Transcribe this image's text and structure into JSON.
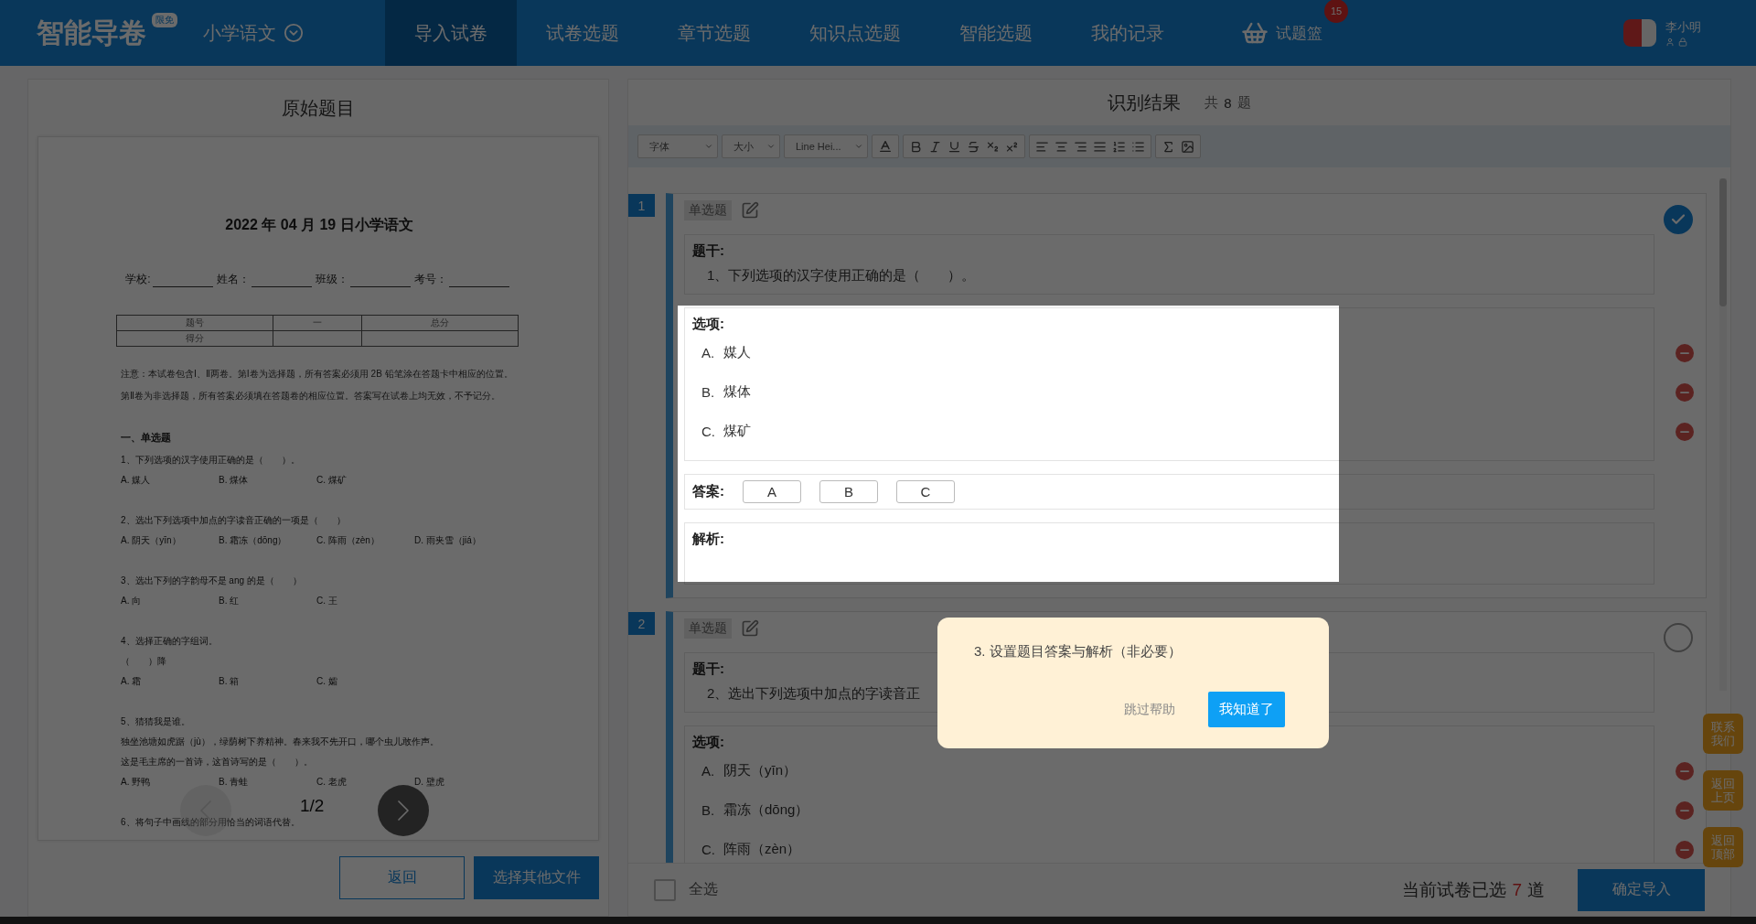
{
  "header": {
    "logo": "智能导卷",
    "logo_badge": "限免",
    "subject": "小学语文",
    "nav": [
      {
        "label": "导入试卷",
        "selected": true
      },
      {
        "label": "试卷选题",
        "selected": false
      },
      {
        "label": "章节选题",
        "selected": false
      },
      {
        "label": "知识点选题",
        "selected": false
      },
      {
        "label": "智能选题",
        "selected": false
      },
      {
        "label": "我的记录",
        "selected": false
      }
    ],
    "basket": {
      "label": "试题篮",
      "count": "15"
    },
    "user": {
      "name": "李小明"
    }
  },
  "left_panel": {
    "title": "原始题目",
    "document": {
      "title": "2022 年 04 月 19 日小学语文",
      "fields": [
        "学校:",
        "姓名：",
        "班级：",
        "考号："
      ],
      "score_table": [
        [
          "题号",
          "一",
          "总分"
        ],
        [
          "得分"
        ]
      ],
      "notice": "注意：本试卷包含Ⅰ、Ⅱ两卷。第Ⅰ卷为选择题，所有答案必须用 2B 铅笔涂在答题卡中相应的位置。第Ⅱ卷为非选择题，所有答案必须填在答题卷的相应位置。答案写在试卷上均无效，不予记分。",
      "section": "一、单选题",
      "questions": [
        {
          "lines": [
            "1、下列选项的汉字使用正确的是（　　）。"
          ],
          "options": [
            "A. 媒人",
            "B. 煤体",
            "C. 煤矿"
          ]
        },
        {
          "lines": [
            "2、选出下列选项中加点的字读音正确的一项是（　　）"
          ],
          "options": [
            "A. 阴天（yīn）",
            "B. 霜冻（dōng）",
            "C. 阵雨（zèn）",
            "D. 雨夹雪（jiá）"
          ]
        },
        {
          "lines": [
            "3、选出下列的字韵母不是 ang 的是（　　）"
          ],
          "options": [
            "A. 向",
            "B. 红",
            "C. 王"
          ]
        },
        {
          "lines": [
            "4、选择正确的字组词。",
            "（　　）降"
          ],
          "options": [
            "A. 霜",
            "B. 箱",
            "C. 孀"
          ]
        },
        {
          "lines": [
            "5、猜猜我是谁。",
            "独坐池塘如虎踞（jù），绿荫树下养精神。春来我不先开口，哪个虫儿敢作声。",
            "这是毛主席的一首诗，这首诗写的是（　　）。"
          ],
          "options": [
            "A. 野鸭",
            "B. 青蛙",
            "C. 老虎",
            "D. 壁虎"
          ]
        },
        {
          "lines": [
            "6、将句子中画线的部分用恰当的词语代替。"
          ]
        }
      ]
    },
    "pager": {
      "label": "1/2",
      "prev_disabled": true,
      "next_disabled": false
    },
    "buttons": [
      {
        "label": "返回",
        "kind": "outline"
      },
      {
        "label": "选择其他文件",
        "kind": "primary"
      }
    ]
  },
  "right_panel": {
    "title": "识别结果",
    "count_prefix": "共",
    "count": "8",
    "count_suffix": "题",
    "toolbar": {
      "selects": [
        "字体",
        "大小",
        "Line Hei..."
      ]
    },
    "questions": [
      {
        "number": "1",
        "type": "单选题",
        "selected": true,
        "stem_label": "题干:",
        "stem": "1、下列选项的汉字使用正确的是（　　）。",
        "options_label": "选项:",
        "options": [
          {
            "letter": "A.",
            "text": "媒人"
          },
          {
            "letter": "B.",
            "text": "煤体"
          },
          {
            "letter": "C.",
            "text": "煤矿"
          }
        ],
        "answer_label": "答案:",
        "answers": [
          "A",
          "B",
          "C"
        ],
        "analysis_label": "解析:"
      },
      {
        "number": "2",
        "type": "单选题",
        "selected": false,
        "stem_label": "题干:",
        "stem": "2、选出下列选项中加点的字读音正",
        "options_label": "选项:",
        "options": [
          {
            "letter": "A.",
            "text": "阴天（yīn）"
          },
          {
            "letter": "B.",
            "text": "霜冻（dōng）"
          },
          {
            "letter": "C.",
            "text": "阵雨（zèn）"
          }
        ]
      }
    ],
    "footer": {
      "select_all": {
        "label": "全选",
        "checked": false
      },
      "selected_prefix": "当前试卷已选",
      "selected_count": "7",
      "selected_suffix": "道",
      "confirm": "确定导入"
    }
  },
  "float_buttons": [
    "联系我们",
    "返回上页",
    "返回顶部"
  ],
  "help_dialog": {
    "text": "3. 设置题目答案与解析（非必要）",
    "skip": "跳过帮助",
    "ok": "我知道了"
  }
}
